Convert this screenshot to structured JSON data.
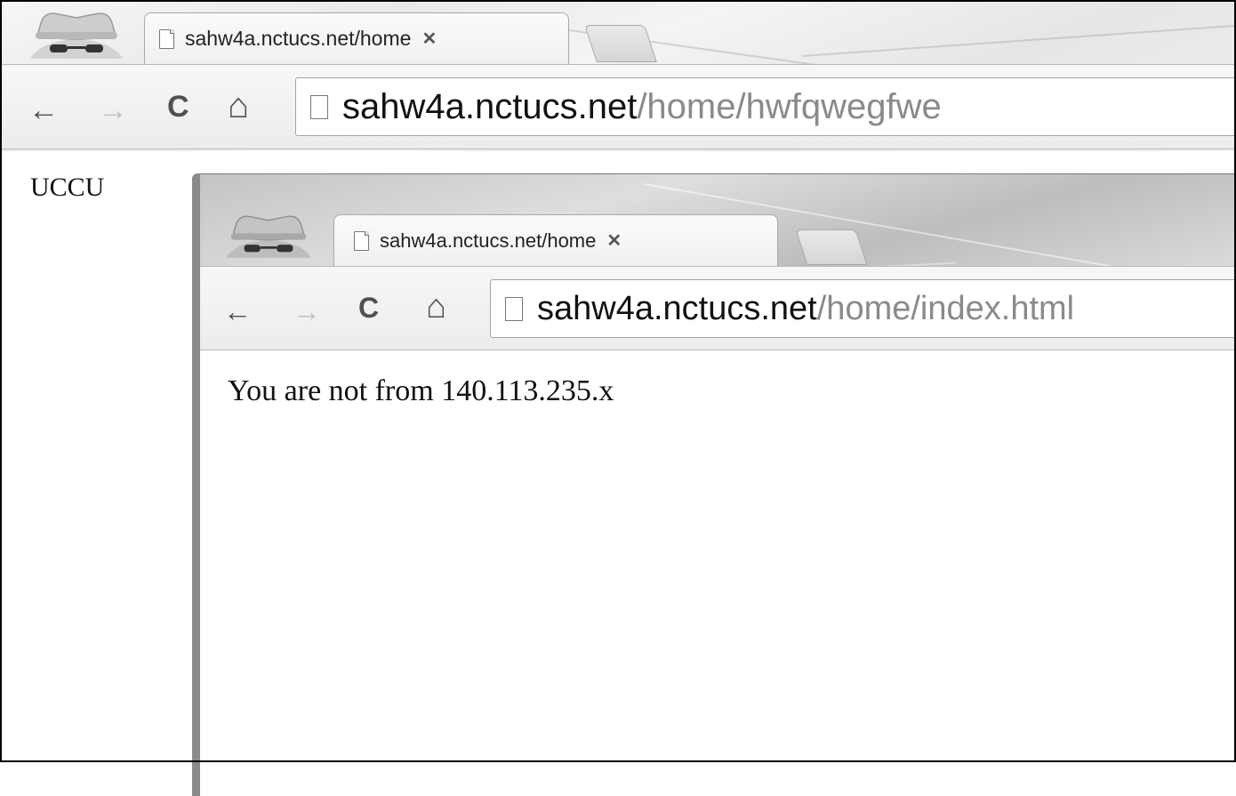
{
  "outer_browser": {
    "tab_title": "sahw4a.nctucs.net/home",
    "url_host": "sahw4a.nctucs.net",
    "url_path": "/home/hwfqwegfwe",
    "page_text": "UCCU"
  },
  "inner_browser": {
    "tab_title": "sahw4a.nctucs.net/home",
    "url_host": "sahw4a.nctucs.net",
    "url_path": "/home/index.html",
    "page_text": "You are not from 140.113.235.x"
  },
  "glyphs": {
    "close": "✕",
    "back": "←",
    "forward": "→",
    "reload": "C",
    "home": "⌂"
  }
}
